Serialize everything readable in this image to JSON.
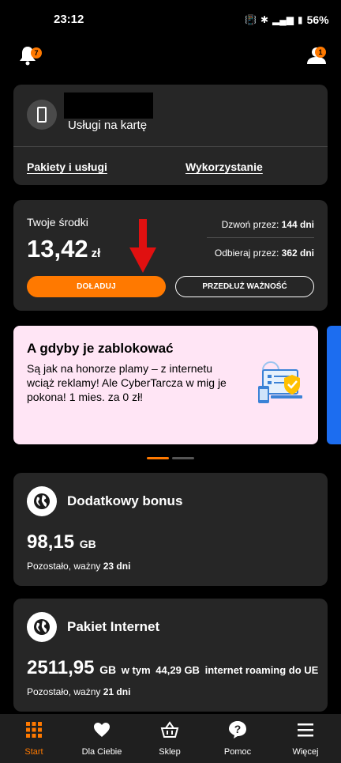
{
  "status_bar": {
    "time": "23:12",
    "battery": "56%"
  },
  "header": {
    "notifications_count": "7",
    "profile_count": "1"
  },
  "account": {
    "plan_name": "Usługi na kartę",
    "links": [
      "Pakiety i usługi",
      "Wykorzystanie"
    ]
  },
  "balance": {
    "label": "Twoje środki",
    "amount": "13,42",
    "currency": "zł",
    "call_label": "Dzwoń przez:",
    "call_value": "144 dni",
    "receive_label": "Odbieraj przez:",
    "receive_value": "362 dni",
    "topup_button": "DOŁADUJ",
    "extend_button": "PRZEDŁUŻ WAŻNOŚĆ"
  },
  "promo": {
    "title": "A gdyby je zablokować",
    "text": "Są jak na honorze plamy – z internetu wciąż reklamy! Ale CyberTarcza w mig je pokona! 1 mies. za 0 zł!"
  },
  "packages": [
    {
      "title": "Dodatkowy bonus",
      "amount": "98,15",
      "unit": "GB",
      "extra_prefix": "",
      "extra_value": "",
      "extra_suffix": "",
      "note_prefix": "Pozostało, ważny",
      "note_value": "23 dni"
    },
    {
      "title": "Pakiet Internet",
      "amount": "2511,95",
      "unit": "GB",
      "extra_prefix": "w tym",
      "extra_value": "44,29 GB",
      "extra_suffix": "internet roaming do UE",
      "note_prefix": "Pozostało, ważny",
      "note_value": "21 dni"
    }
  ],
  "nav": {
    "items": [
      "Start",
      "Dla Ciebie",
      "Sklep",
      "Pomoc",
      "Więcej"
    ],
    "active": "Start"
  },
  "colors": {
    "accent": "#ff7900",
    "card": "#262626",
    "promo_bg": "#ffe5f5",
    "arrow": "#e01010"
  },
  "icons": [
    "bell-icon",
    "profile-icon",
    "phone-icon",
    "globe-icon",
    "grid-icon",
    "heart-icon",
    "basket-icon",
    "question-icon",
    "menu-icon",
    "shield-icon"
  ]
}
